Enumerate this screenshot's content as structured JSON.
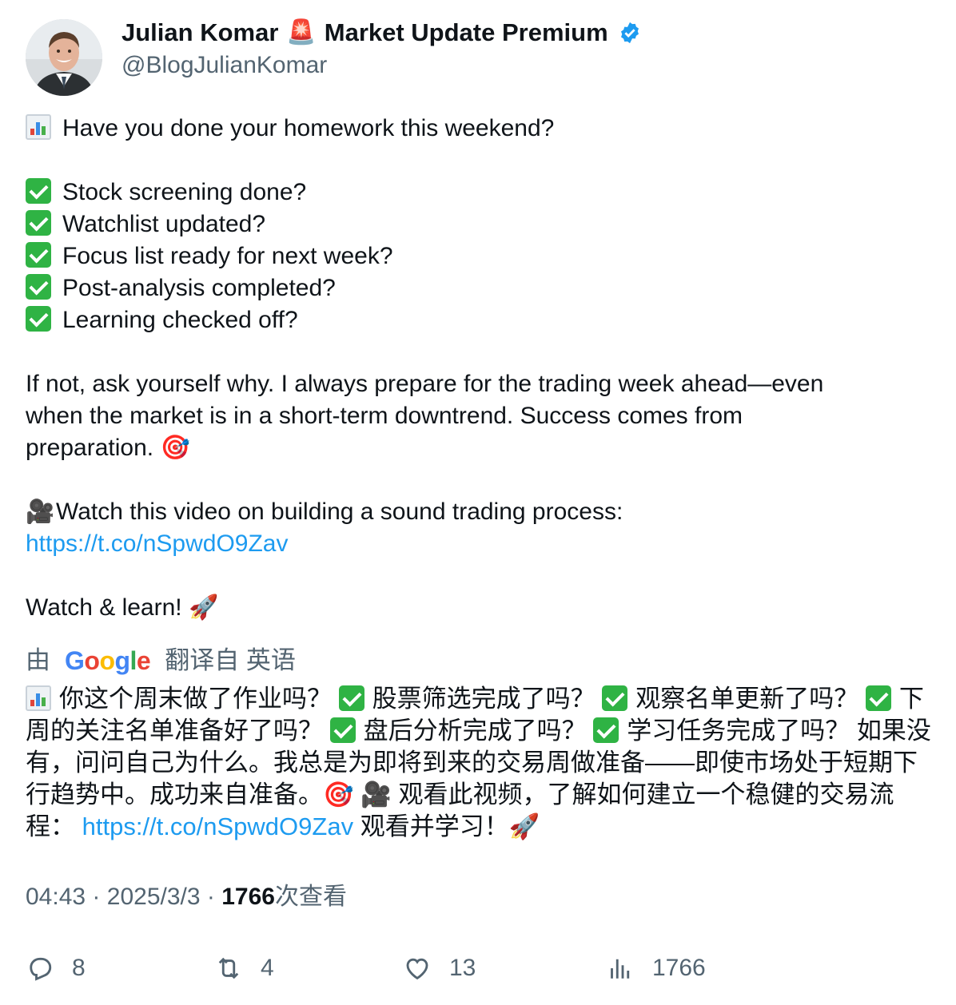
{
  "author": {
    "name": "Julian Komar",
    "siren_emoji": "🚨",
    "name_suffix": "Market Update Premium",
    "handle": "@BlogJulianKomar",
    "verified": true
  },
  "tweet": {
    "line1": "Have you done your homework this weekend?",
    "checklist": [
      "Stock screening done?",
      "Watchlist updated?",
      "Focus list ready for next week?",
      "Post-analysis completed?",
      "Learning checked off?"
    ],
    "para_line1": "If not, ask yourself why. I always prepare for the trading week ahead—even",
    "para_line2": "when the market is in a short-term downtrend. Success comes from",
    "para_line3": "preparation.",
    "target_emoji": "🎯",
    "camera_emoji": "🎥",
    "video_text": "Watch this video on building a sound trading process:",
    "link": "https://t.co/nSpwdO9Zav",
    "closing": "Watch & learn!",
    "rocket_emoji": "🚀"
  },
  "translation_banner": {
    "prefix": "由",
    "google": [
      "G",
      "o",
      "o",
      "g",
      "l",
      "e"
    ],
    "suffix": "翻译自 英语"
  },
  "translation": {
    "t1": "你这个周末做了作业吗？",
    "t2": "股票筛选完成了吗？",
    "t3": "观察名单更新了吗？",
    "t4": "下周的关注名单准备好了吗？",
    "t5": "盘后分析完成了吗？",
    "t6": "学习任务完成了吗？ 如果没有，问问自己为什么。我总是为即将到来的交易周做准备——即使市场处于短期下行趋势中。成功来自准备。",
    "t7": "观看此视频，了解如何建立一个稳健的交易流程：",
    "link": "https://t.co/nSpwdO9Zav",
    "t8": "观看并学习！"
  },
  "meta": {
    "time": "04:43",
    "date": "2025/3/3",
    "views": "1766",
    "views_label": "次查看"
  },
  "actions": {
    "replies": "8",
    "reposts": "4",
    "likes": "13",
    "views": "1766"
  },
  "colors": {
    "text": "#0f1419",
    "secondary": "#536471",
    "link": "#1d9bf0",
    "check": "#2fb344"
  }
}
